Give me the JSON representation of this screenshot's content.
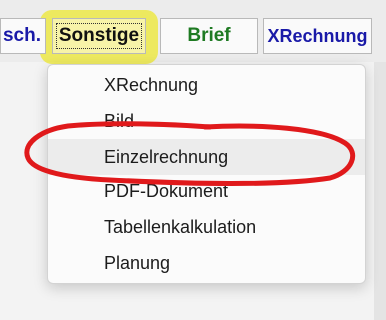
{
  "toolbar": {
    "tabs": [
      {
        "label": "sch."
      },
      {
        "label": "Sonstige"
      },
      {
        "label": "Brief"
      },
      {
        "label": "XRechnung"
      }
    ]
  },
  "menu": {
    "items": [
      {
        "label": "XRechnung"
      },
      {
        "label": "Bild"
      },
      {
        "label": "Einzelrechnung"
      },
      {
        "label": "PDF-Dokument"
      },
      {
        "label": "Tabellenkalkulation"
      },
      {
        "label": "Planung"
      }
    ],
    "highlighted_item": "Einzelrechnung"
  },
  "colors": {
    "annotation_circle": "#e0191b",
    "highlight": "#eee814",
    "brief_text": "#1e7a22",
    "xrechnung_text": "#1a1aa8"
  }
}
